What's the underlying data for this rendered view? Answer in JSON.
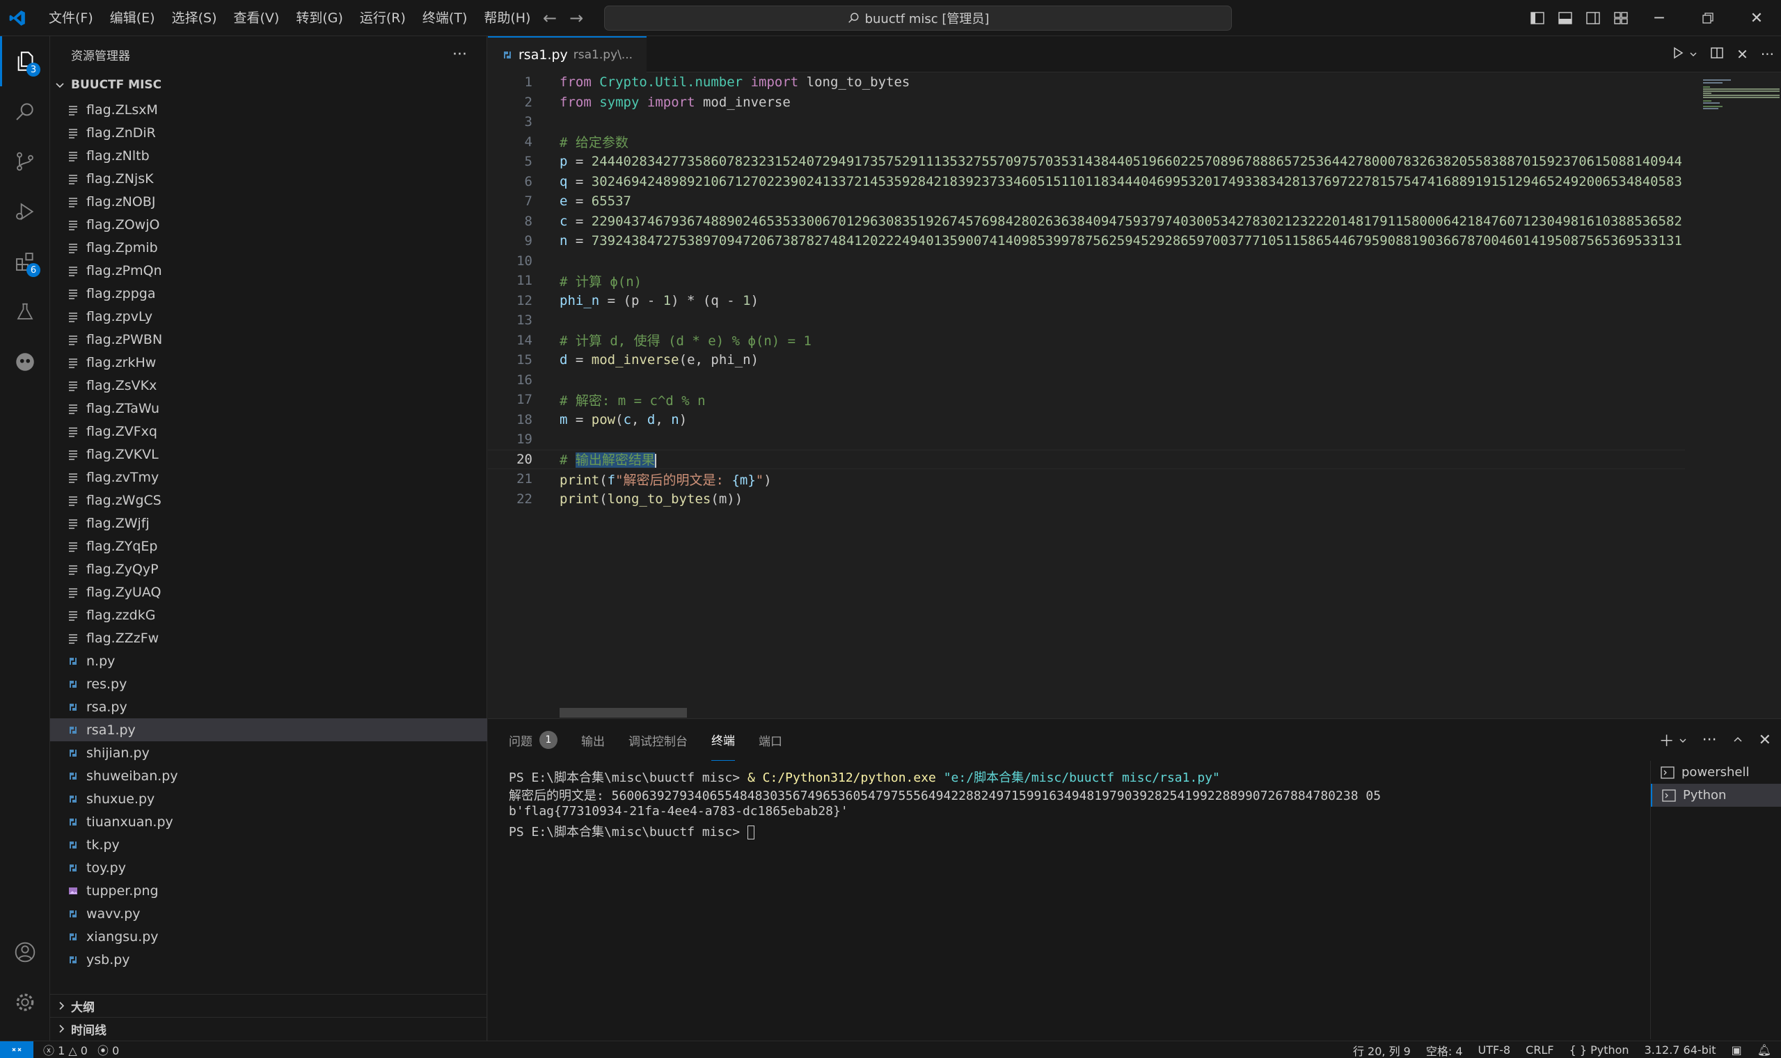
{
  "titlebar": {
    "menu": [
      "文件(F)",
      "编辑(E)",
      "选择(S)",
      "查看(V)",
      "转到(G)",
      "运行(R)",
      "终端(T)",
      "帮助(H)"
    ],
    "search_text": "buuctf misc [管理员]"
  },
  "activity": {
    "explorer_badge": "3",
    "extensions_badge": "6"
  },
  "sidebar": {
    "title": "资源管理器",
    "folder": "BUUCTF MISC",
    "files": [
      {
        "name": "flag.ZLsxM",
        "type": "text"
      },
      {
        "name": "flag.ZnDiR",
        "type": "text"
      },
      {
        "name": "flag.zNltb",
        "type": "text"
      },
      {
        "name": "flag.ZNjsK",
        "type": "text"
      },
      {
        "name": "flag.zNOBJ",
        "type": "text"
      },
      {
        "name": "flag.ZOwjO",
        "type": "text"
      },
      {
        "name": "flag.Zpmib",
        "type": "text"
      },
      {
        "name": "flag.zPmQn",
        "type": "text"
      },
      {
        "name": "flag.zppga",
        "type": "text"
      },
      {
        "name": "flag.zpvLy",
        "type": "text"
      },
      {
        "name": "flag.zPWBN",
        "type": "text"
      },
      {
        "name": "flag.zrkHw",
        "type": "text"
      },
      {
        "name": "flag.ZsVKx",
        "type": "text"
      },
      {
        "name": "flag.ZTaWu",
        "type": "text"
      },
      {
        "name": "flag.ZVFxq",
        "type": "text"
      },
      {
        "name": "flag.ZVKVL",
        "type": "text"
      },
      {
        "name": "flag.zvTmy",
        "type": "text"
      },
      {
        "name": "flag.zWgCS",
        "type": "text"
      },
      {
        "name": "flag.ZWjfj",
        "type": "text"
      },
      {
        "name": "flag.ZYqEp",
        "type": "text"
      },
      {
        "name": "flag.ZyQyP",
        "type": "text"
      },
      {
        "name": "flag.ZyUAQ",
        "type": "text"
      },
      {
        "name": "flag.zzdkG",
        "type": "text"
      },
      {
        "name": "flag.ZZzFw",
        "type": "text"
      },
      {
        "name": "n.py",
        "type": "python"
      },
      {
        "name": "res.py",
        "type": "python"
      },
      {
        "name": "rsa.py",
        "type": "python"
      },
      {
        "name": "rsa1.py",
        "type": "python",
        "selected": true
      },
      {
        "name": "shijian.py",
        "type": "python"
      },
      {
        "name": "shuweiban.py",
        "type": "python"
      },
      {
        "name": "shuxue.py",
        "type": "python"
      },
      {
        "name": "tiuanxuan.py",
        "type": "python"
      },
      {
        "name": "tk.py",
        "type": "python"
      },
      {
        "name": "toy.py",
        "type": "python"
      },
      {
        "name": "tupper.png",
        "type": "image"
      },
      {
        "name": "wavv.py",
        "type": "python"
      },
      {
        "name": "xiangsu.py",
        "type": "python"
      },
      {
        "name": "ysb.py",
        "type": "python"
      }
    ],
    "outline_label": "大纲",
    "timeline_label": "时间线"
  },
  "editor": {
    "tab_name": "rsa1.py",
    "tab_path": "rsa1.py\\...",
    "current_line": 20,
    "lines": [
      "from Crypto.Util.number import long_to_bytes",
      "from sympy import mod_inverse",
      "",
      "# 给定参数",
      "p = 24440283427735860782323152407294917357529111353275570975703531438440519660225708967888657253644278000783263820558388701592370615088140944",
      "q = 30246942489892106712702239024133721453592842183923733460515110118344404699532017493383428137697227815754741688919151294652492006534840583",
      "e = 65537",
      "c = 22904374679367488902465353300670129630835192674576984280263638409475937974030053427830212322201481791158000642184760712304981610388536582",
      "n = 73924384727538970947206738782748412022249401359007414098539978756259452928659700377710511586544679590881903667870046014195087565369533131",
      "",
      "# 计算 ϕ(n)",
      "phi_n = (p - 1) * (q - 1)",
      "",
      "# 计算 d, 使得 (d * e) % ϕ(n) = 1",
      "d = mod_inverse(e, phi_n)",
      "",
      "# 解密: m = c^d % n",
      "m = pow(c, d, n)",
      "",
      "# 输出解密结果",
      "print(f\"解密后的明文是: {m}\")",
      "print(long_to_bytes(m))"
    ]
  },
  "panel": {
    "tabs": [
      "问题",
      "输出",
      "调试控制台",
      "终端",
      "端口"
    ],
    "problems_count": "1",
    "active_tab": "终端",
    "terminal_lines": {
      "prompt1": "PS E:\\脚本合集\\misc\\buuctf misc> ",
      "cmd_amp": "& ",
      "cmd_exe": "C:/Python312/python.exe ",
      "cmd_arg": "\"e:/脚本合集/misc/buuctf misc/rsa1.py\"",
      "out1": "解密后的明文是: 560063927934065548483035674965360547975556494228824971599163494819790392825419922889907267884780238 05",
      "out2": "b'flag{77310934-21fa-4ee4-a783-dc1865ebab28}'",
      "prompt2": "PS E:\\脚本合集\\misc\\buuctf misc> "
    },
    "terminals": [
      "powershell",
      "Python"
    ]
  },
  "statusbar": {
    "errors": "1",
    "warnings": "0",
    "ports": "0",
    "position": "行 20, 列 9",
    "spaces": "空格: 4",
    "encoding": "UTF-8",
    "eol": "CRLF",
    "language": "{ } Python",
    "interpreter": "3.12.7 64-bit"
  }
}
